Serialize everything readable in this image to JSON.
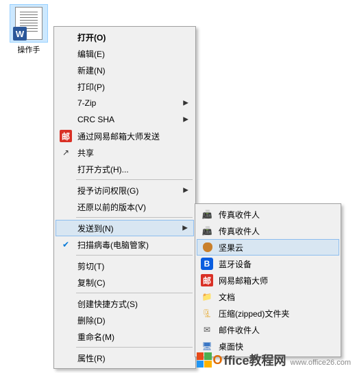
{
  "file": {
    "label": "操作手"
  },
  "menu1": {
    "open": "打开(O)",
    "edit": "编辑(E)",
    "new": "新建(N)",
    "print": "打印(P)",
    "sevenzip": "7-Zip",
    "crcsha": "CRC SHA",
    "netease": "通过网易邮箱大师发送",
    "share": "共享",
    "openwith": "打开方式(H)...",
    "grantaccess": "授予访问权限(G)",
    "restore": "还原以前的版本(V)",
    "sendto": "发送到(N)",
    "scan": "扫描病毒(电脑管家)",
    "cut": "剪切(T)",
    "copy": "复制(C)",
    "shortcut": "创建快捷方式(S)",
    "delete": "删除(D)",
    "rename": "重命名(M)",
    "properties": "属性(R)"
  },
  "menu2": {
    "fax1": "传真收件人",
    "fax2": "传真收件人",
    "nut": "坚果云",
    "bluetooth": "蓝牙设备",
    "netease": "网易邮箱大师",
    "docs": "文档",
    "zip": "压缩(zipped)文件夹",
    "mailrcpt": "邮件收件人",
    "desktop": "桌面快"
  },
  "watermark": {
    "brand_o": "O",
    "brand_rest": "ffice教程网",
    "url": "www.office26.com"
  }
}
